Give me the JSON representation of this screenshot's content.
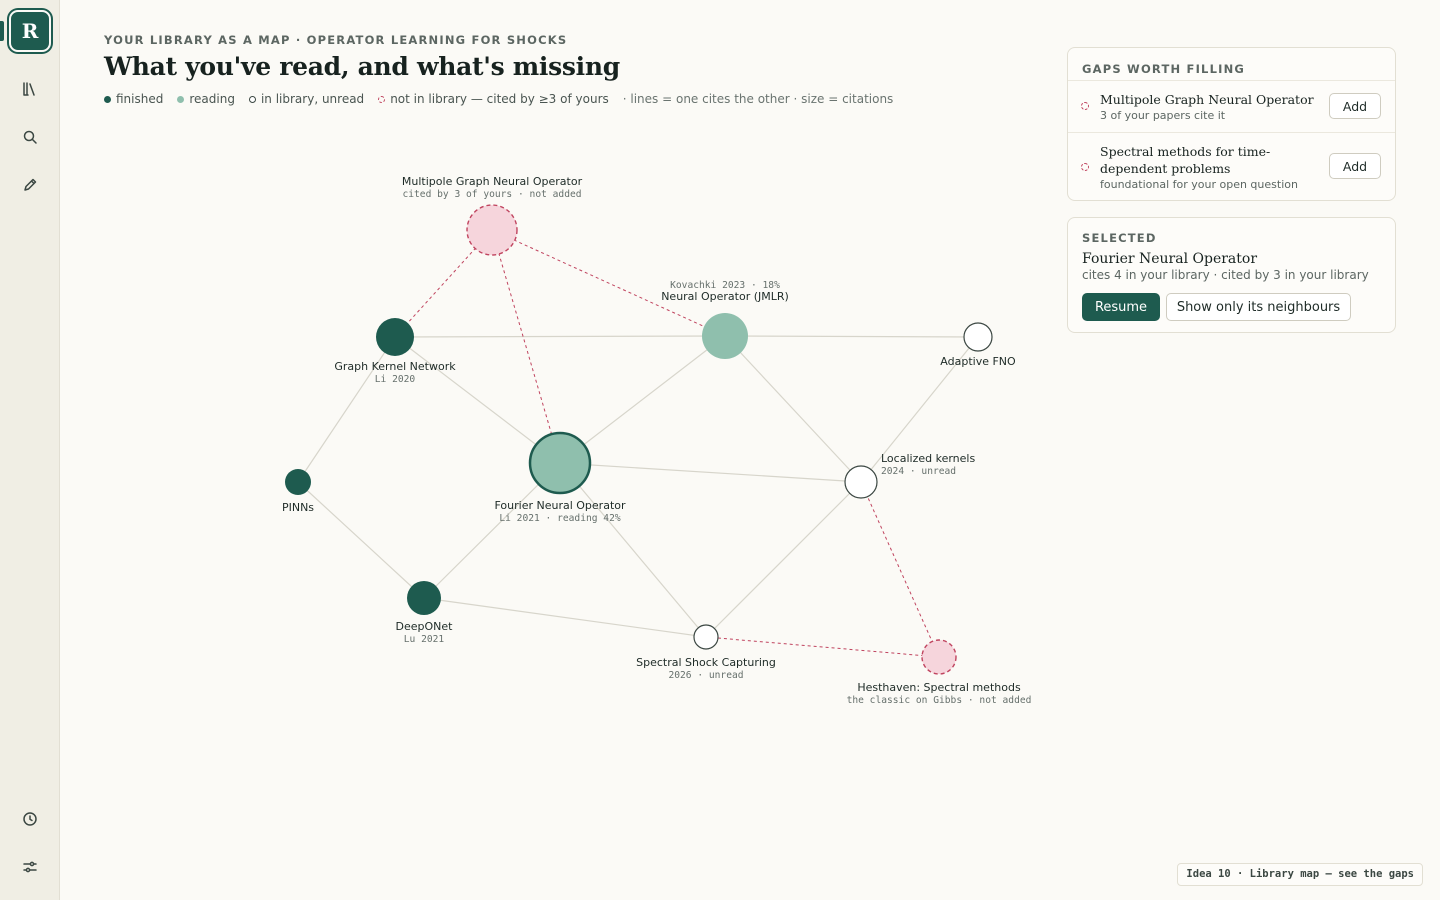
{
  "rail": {
    "logo": "R",
    "top_icons": [
      "library-icon",
      "search-icon",
      "pencil-icon"
    ],
    "bottom_icons": [
      "history-icon",
      "settings-sliders-icon"
    ]
  },
  "header": {
    "eyebrow": "YOUR LIBRARY AS A MAP · OPERATOR LEARNING FOR SHOCKS",
    "title": "What you've read, and what's missing",
    "legend": {
      "finished": "finished",
      "reading": "reading",
      "unread": "in library, unread",
      "missing": "not in library — cited by ≥3 of yours",
      "note": "· lines = one cites the other · size = citations"
    }
  },
  "colors": {
    "finished": "#1e5b4f",
    "reading": "#8fbfad",
    "missing_fill": "#f6d5dc",
    "missing_stroke": "#c0445f",
    "background": "#fbfaf6"
  },
  "graph": {
    "nodes": [
      {
        "id": "mgno",
        "name": "Multipole Graph Neural Operator",
        "meta": "cited by 3 of yours · not added",
        "status": "missing",
        "citations": 3
      },
      {
        "id": "gkn",
        "name": "Graph Kernel Network",
        "meta": "Li 2020",
        "status": "finished",
        "citations": 3
      },
      {
        "id": "no",
        "name": "Neural Operator (JMLR)",
        "meta": "Kovachki 2023 · 18%",
        "status": "reading",
        "citations": 4
      },
      {
        "id": "afno",
        "name": "Adaptive FNO",
        "meta": "",
        "status": "unread",
        "citations": 1
      },
      {
        "id": "pinns",
        "name": "PINNs",
        "meta": "",
        "status": "finished",
        "citations": 1
      },
      {
        "id": "fno",
        "name": "Fourier Neural Operator",
        "meta": "Li 2021 · reading 42%",
        "status": "reading",
        "citations": 6,
        "selected": true
      },
      {
        "id": "lk",
        "name": "Localized kernels",
        "meta": "2024 · unread",
        "status": "unread",
        "citations": 2
      },
      {
        "id": "deeponet",
        "name": "DeepONet",
        "meta": "Lu 2021",
        "status": "finished",
        "citations": 3
      },
      {
        "id": "ssc",
        "name": "Spectral Shock Capturing",
        "meta": "2026 · unread",
        "status": "unread",
        "citations": 1
      },
      {
        "id": "hest",
        "name": "Hesthaven: Spectral methods",
        "meta": "the classic on Gibbs · not added",
        "status": "missing",
        "citations": 2
      }
    ],
    "edges": [
      {
        "from": "gkn",
        "to": "no",
        "type": "cite"
      },
      {
        "from": "no",
        "to": "afno",
        "type": "cite"
      },
      {
        "from": "gkn",
        "to": "fno",
        "type": "cite"
      },
      {
        "from": "gkn",
        "to": "pinns",
        "type": "cite"
      },
      {
        "from": "no",
        "to": "fno",
        "type": "cite"
      },
      {
        "from": "no",
        "to": "lk",
        "type": "cite"
      },
      {
        "from": "afno",
        "to": "lk",
        "type": "cite"
      },
      {
        "from": "fno",
        "to": "lk",
        "type": "cite"
      },
      {
        "from": "pinns",
        "to": "deeponet",
        "type": "cite"
      },
      {
        "from": "fno",
        "to": "deeponet",
        "type": "cite"
      },
      {
        "from": "fno",
        "to": "ssc",
        "type": "cite"
      },
      {
        "from": "deeponet",
        "to": "ssc",
        "type": "cite"
      },
      {
        "from": "lk",
        "to": "ssc",
        "type": "cite"
      },
      {
        "from": "mgno",
        "to": "gkn",
        "type": "gap"
      },
      {
        "from": "mgno",
        "to": "fno",
        "type": "gap"
      },
      {
        "from": "mgno",
        "to": "no",
        "type": "gap"
      },
      {
        "from": "lk",
        "to": "hest",
        "type": "gap"
      },
      {
        "from": "ssc",
        "to": "hest",
        "type": "gap"
      }
    ]
  },
  "gaps_panel": {
    "title": "GAPS WORTH FILLING",
    "items": [
      {
        "name": "Multipole Graph Neural Operator",
        "sub": "3 of your papers cite it",
        "button": "Add"
      },
      {
        "name": "Spectral methods for time-dependent problems",
        "sub": "foundational for your open question",
        "button": "Add"
      }
    ]
  },
  "selected_panel": {
    "title": "SELECTED",
    "name": "Fourier Neural Operator",
    "sub": "cites 4 in your library · cited by 3 in your library",
    "primary_button": "Resume",
    "secondary_button": "Show only its neighbours"
  },
  "footer": {
    "tag": "Idea 10 · Library map — see the gaps"
  }
}
